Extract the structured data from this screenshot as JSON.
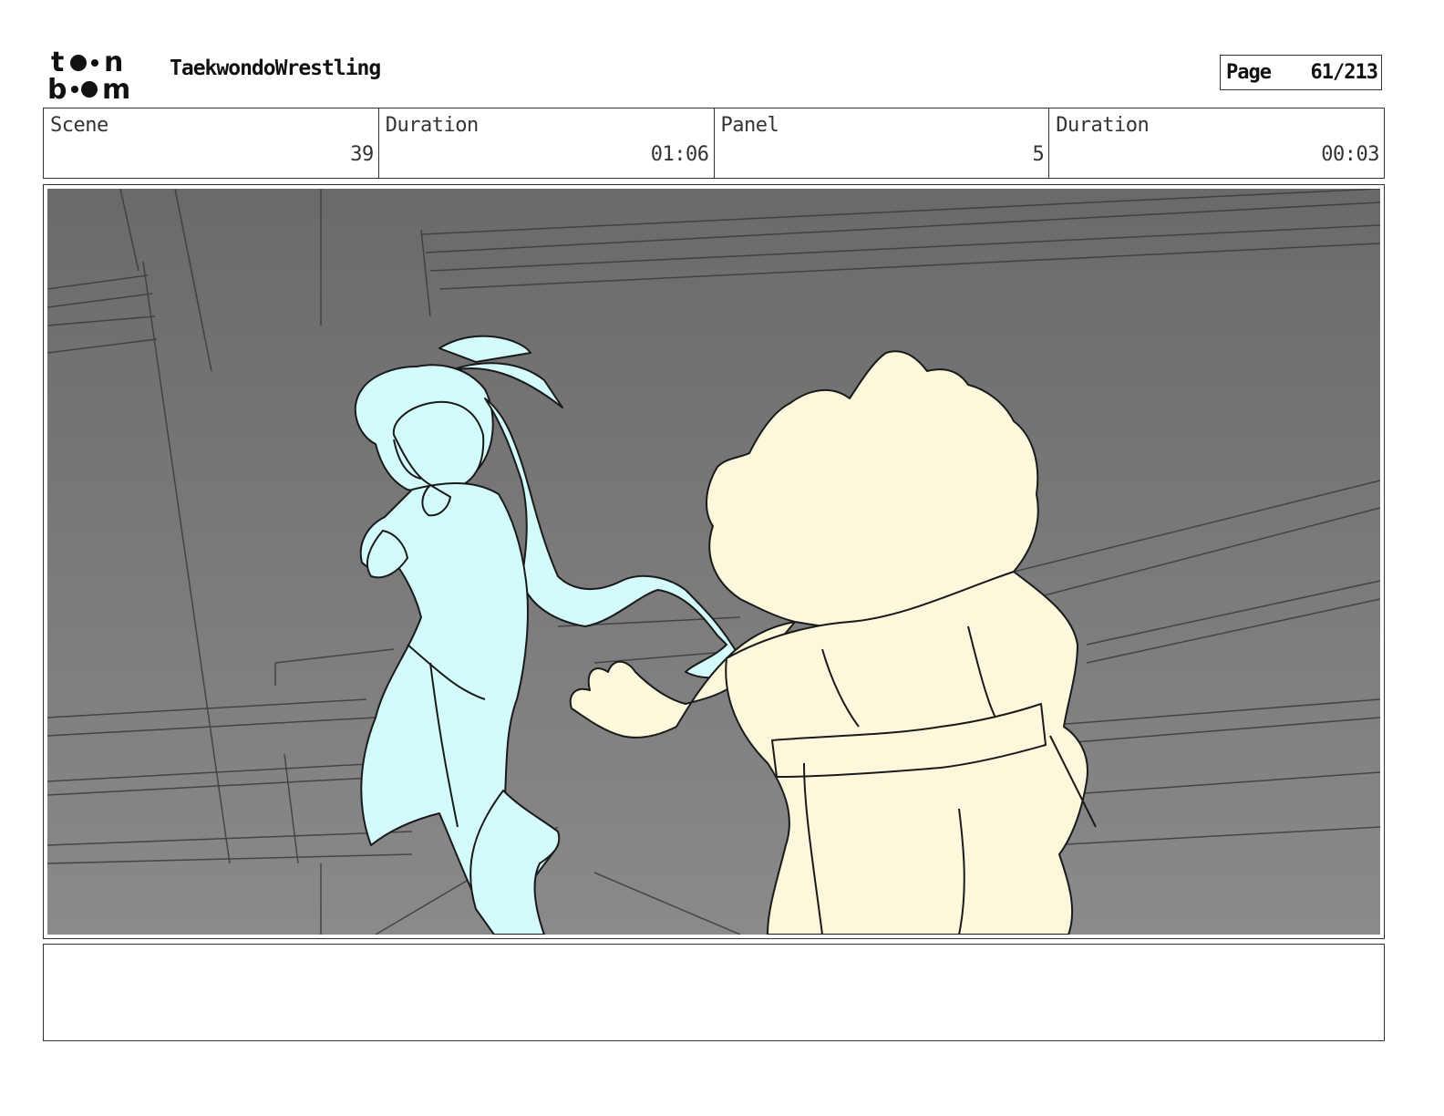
{
  "header": {
    "logo_text": "toon boom",
    "project_title": "TaekwondoWrestling",
    "page_label": "Page",
    "page_value": "61/213"
  },
  "info": [
    {
      "label": "Scene",
      "value": "39"
    },
    {
      "label": "Duration",
      "value": "01:06"
    },
    {
      "label": "Panel",
      "value": "5"
    },
    {
      "label": "Duration",
      "value": "00:03"
    }
  ],
  "panel": {
    "background_color": "#6f6f6f",
    "character_left_color": "#d4fbfb",
    "character_right_color": "#fdf8dc",
    "line_color": "#1a1a1a"
  },
  "notes": {
    "text": ""
  }
}
